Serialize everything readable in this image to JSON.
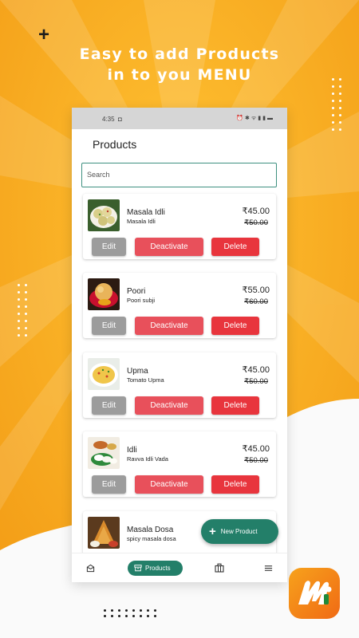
{
  "promo": {
    "headline_line1": "Easy to add Products",
    "headline_line2": "in to you MENU"
  },
  "status_bar": {
    "time": "4:35"
  },
  "header": {
    "title": "Products"
  },
  "search": {
    "placeholder": "Search"
  },
  "buttons": {
    "edit": "Edit",
    "deactivate": "Deactivate",
    "delete": "Delete"
  },
  "products": [
    {
      "name": "Masala Idli",
      "description": "Masala Idli",
      "price": "₹45.00",
      "original_price": "₹50.00"
    },
    {
      "name": "Poori",
      "description": "Poori subji",
      "price": "₹55.00",
      "original_price": "₹60.00"
    },
    {
      "name": "Upma",
      "description": "Tomato Upma",
      "price": "₹45.00",
      "original_price": "₹50.00"
    },
    {
      "name": "Idli",
      "description": "Ravva Idli Vada",
      "price": "₹45.00",
      "original_price": "₹50.00"
    },
    {
      "name": "Masala Dosa",
      "description": "spicy masala dosa"
    }
  ],
  "fab": {
    "label": "New Product"
  },
  "bottom_nav": {
    "active_label": "Products"
  },
  "colors": {
    "brand_green": "#237f69",
    "deactivate": "#e8505b",
    "delete": "#e8353d",
    "edit": "#9c9c9c",
    "background_orange": "#f3a21a"
  }
}
